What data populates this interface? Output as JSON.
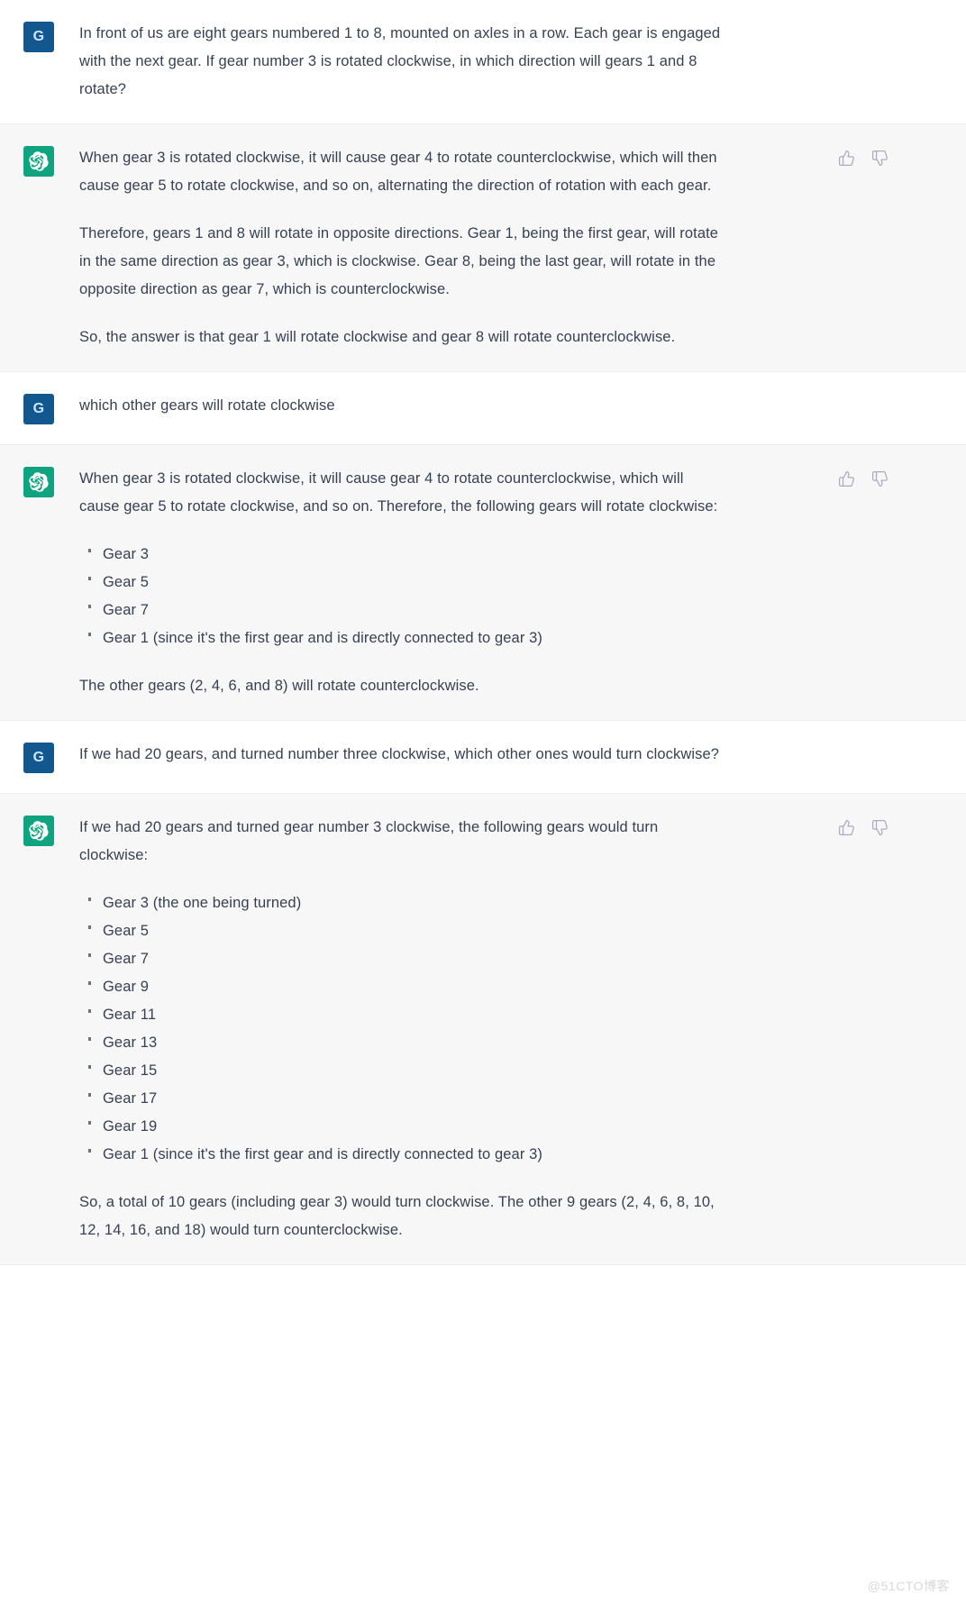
{
  "avatars": {
    "user_initial": "G",
    "assistant_icon": "openai-logo-icon",
    "user_bg": "#12588f",
    "assistant_bg": "#10a37f"
  },
  "feedback": {
    "thumbs_up_icon": "thumbs-up-icon",
    "thumbs_down_icon": "thumbs-down-icon"
  },
  "watermark": "@51CTO博客",
  "messages": [
    {
      "role": "user",
      "paragraphs": [
        "In front of us are eight gears numbered 1 to 8, mounted on axles in a row. Each gear is engaged with the next gear. If gear number 3 is rotated clockwise, in which direction will gears 1 and 8 rotate?"
      ]
    },
    {
      "role": "assistant",
      "paragraphs": [
        "When gear 3 is rotated clockwise, it will cause gear 4 to rotate counterclockwise, which will then cause gear 5 to rotate clockwise, and so on, alternating the direction of rotation with each gear.",
        "Therefore, gears 1 and 8 will rotate in opposite directions. Gear 1, being the first gear, will rotate in the same direction as gear 3, which is clockwise. Gear 8, being the last gear, will rotate in the opposite direction as gear 7, which is counterclockwise.",
        "So, the answer is that gear 1 will rotate clockwise and gear 8 will rotate counterclockwise."
      ]
    },
    {
      "role": "user",
      "paragraphs": [
        "which other gears will rotate clockwise"
      ]
    },
    {
      "role": "assistant",
      "intro": "When gear 3 is rotated clockwise, it will cause gear 4 to rotate counterclockwise, which will cause gear 5 to rotate clockwise, and so on. Therefore, the following gears will rotate clockwise:",
      "list": [
        "Gear 3",
        "Gear 5",
        "Gear 7",
        "Gear 1 (since it's the first gear and is directly connected to gear 3)"
      ],
      "outro": "The other gears (2, 4, 6, and 8) will rotate counterclockwise."
    },
    {
      "role": "user",
      "paragraphs": [
        "If we had 20 gears, and turned number three clockwise, which other ones would turn clockwise?"
      ]
    },
    {
      "role": "assistant",
      "intro": "If we had 20 gears and turned gear number 3 clockwise, the following gears would turn clockwise:",
      "list": [
        "Gear 3 (the one being turned)",
        "Gear 5",
        "Gear 7",
        "Gear 9",
        "Gear 11",
        "Gear 13",
        "Gear 15",
        "Gear 17",
        "Gear 19",
        "Gear 1 (since it's the first gear and is directly connected to gear 3)"
      ],
      "outro": "So, a total of 10 gears (including gear 3) would turn clockwise. The other 9 gears (2, 4, 6, 8, 10, 12, 14, 16, and 18) would turn counterclockwise."
    }
  ]
}
